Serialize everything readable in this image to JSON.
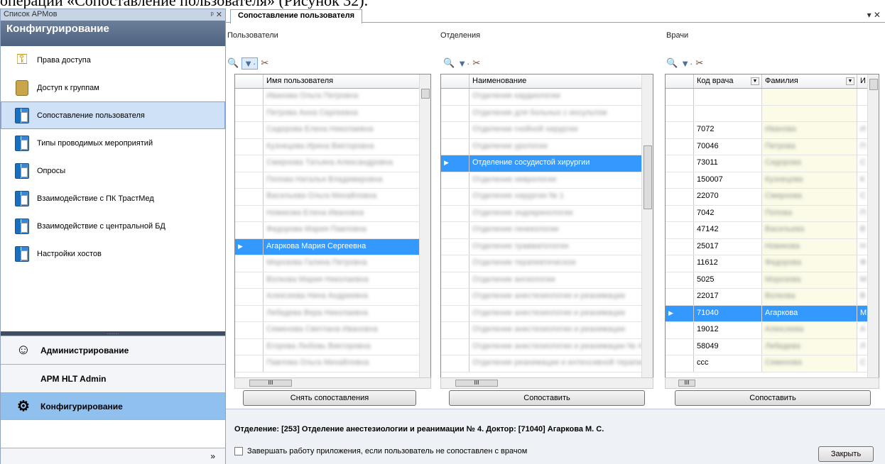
{
  "page_top_text": "операции «Сопоставление пользователя» (Рисунок 32).",
  "left_panel": {
    "title": "Список АРМов",
    "pin_controls": "ᵖ ✕",
    "header": "Конфигурирование",
    "items": [
      {
        "label": "Права доступа",
        "icon": "keys-icon"
      },
      {
        "label": "Доступ к группам",
        "icon": "lock-icon"
      },
      {
        "label": "Сопоставление пользователя",
        "icon": "book-icon",
        "selected": true
      },
      {
        "label": "Типы проводимых мероприятий",
        "icon": "book-icon"
      },
      {
        "label": "Опросы",
        "icon": "book-icon"
      },
      {
        "label": "Взаимодействие с ПК ТрастМед",
        "icon": "book-icon"
      },
      {
        "label": "Взаимодействие с центральной БД",
        "icon": "book-icon"
      },
      {
        "label": "Настройки хостов",
        "icon": "book-icon"
      }
    ],
    "splitter_dots": "..........",
    "bottom_buttons": [
      {
        "label": "Администрирование",
        "icon": "admin-icon"
      },
      {
        "label": "АРМ HLT Admin",
        "icon": ""
      },
      {
        "label": "Конфигурирование",
        "icon": "config-icon",
        "active": true
      }
    ],
    "more_label": "»"
  },
  "tab": {
    "label": "Сопоставление пользователя",
    "controls": "▾ ✕"
  },
  "users": {
    "title": "Пользователи",
    "column": "Имя пользователя",
    "rows": [
      {
        "name": "Иванова Ольга Петровна",
        "blurred": true
      },
      {
        "name": "Петрова Анна Сергеевна",
        "blurred": true
      },
      {
        "name": "Сидорова Елена Николаевна",
        "blurred": true
      },
      {
        "name": "Кузнецова Ирина Викторовна",
        "blurred": true
      },
      {
        "name": "Смирнова Татьяна Александровна",
        "blurred": true
      },
      {
        "name": "Попова Наталья Владимировна",
        "blurred": true
      },
      {
        "name": "Васильева Ольга Михайловна",
        "blurred": true
      },
      {
        "name": "Новикова Елена Ивановна",
        "blurred": true
      },
      {
        "name": "Федорова Мария Павловна",
        "blurred": true
      },
      {
        "name": "Агаркова Мария Сергеевна",
        "blurred": false,
        "selected": true
      },
      {
        "name": "Морозова Галина Петровна",
        "blurred": true
      },
      {
        "name": "Волкова Мария Николаевна",
        "blurred": true
      },
      {
        "name": "Алексеева Нина Андреевна",
        "blurred": true
      },
      {
        "name": "Лебедева Вера Николаевна",
        "blurred": true
      },
      {
        "name": "Семенова Светлана Ивановна",
        "blurred": true
      },
      {
        "name": "Егорова Любовь Викторовна",
        "blurred": true
      },
      {
        "name": "Павлова Ольга Михайловна",
        "blurred": true
      }
    ],
    "button": "Снять сопоставления",
    "hscroll": "III"
  },
  "departments": {
    "title": "Отделения",
    "column": "Наименование",
    "rows": [
      {
        "name": "Отделение кардиологии",
        "blurred": true
      },
      {
        "name": "Отделение для больных с инсультом",
        "blurred": true
      },
      {
        "name": "Отделение гнойной хирургии",
        "blurred": true
      },
      {
        "name": "Отделение урологии",
        "blurred": true
      },
      {
        "name": "Отделение сосудистой хирургии",
        "blurred": false,
        "selected": true
      },
      {
        "name": "Отделение неврологии",
        "blurred": true
      },
      {
        "name": "Отделение хирургии № 1",
        "blurred": true
      },
      {
        "name": "Отделение эндокринологии",
        "blurred": true
      },
      {
        "name": "Отделение гинекологии",
        "blurred": true
      },
      {
        "name": "Отделение травматологии",
        "blurred": true
      },
      {
        "name": "Отделение терапевтическое",
        "blurred": true
      },
      {
        "name": "Отделение ангиологии",
        "blurred": true
      },
      {
        "name": "Отделение анестезиологии и реанимации",
        "blurred": true
      },
      {
        "name": "Отделение анестезиологии и реанимации",
        "blurred": true
      },
      {
        "name": "Отделение анестезиологии и реанимации",
        "blurred": true
      },
      {
        "name": "Отделение анестезиологии и реанимации № 4",
        "blurred": true
      },
      {
        "name": "Отделение реанимации и интенсивной терапии",
        "blurred": true
      }
    ],
    "button": "Сопоставить",
    "hscroll": "III"
  },
  "doctors": {
    "title": "Врачи",
    "columns": [
      "Код врача",
      "Фамилия",
      "И"
    ],
    "rows": [
      {
        "code": "",
        "surname": "",
        "blurred": false
      },
      {
        "code": "",
        "surname": "",
        "blurred": false
      },
      {
        "code": "7072",
        "surname": "Иванова",
        "initial": "И",
        "blurred": true
      },
      {
        "code": "70046",
        "surname": "Петрова",
        "initial": "П",
        "blurred": true
      },
      {
        "code": "73011",
        "surname": "Сидорова",
        "initial": "С",
        "blurred": true
      },
      {
        "code": "150007",
        "surname": "Кузнецова",
        "initial": "К",
        "blurred": true
      },
      {
        "code": "22070",
        "surname": "Смирнова",
        "initial": "С",
        "blurred": true
      },
      {
        "code": "7042",
        "surname": "Попова",
        "initial": "П",
        "blurred": true
      },
      {
        "code": "47142",
        "surname": "Васильева",
        "initial": "В",
        "blurred": true
      },
      {
        "code": "25017",
        "surname": "Новикова",
        "initial": "Н",
        "blurred": true
      },
      {
        "code": "11612",
        "surname": "Федорова",
        "initial": "Ф",
        "blurred": true
      },
      {
        "code": "5025",
        "surname": "Морозова",
        "initial": "М",
        "blurred": true
      },
      {
        "code": "22017",
        "surname": "Волкова",
        "initial": "В",
        "blurred": true
      },
      {
        "code": "71040",
        "surname": "Агаркова",
        "initial": "M",
        "blurred": false,
        "selected": true
      },
      {
        "code": "19012",
        "surname": "Алексеева",
        "initial": "А",
        "blurred": true
      },
      {
        "code": "58049",
        "surname": "Лебедева",
        "initial": "Л",
        "blurred": true
      },
      {
        "code": "ccc",
        "surname": "Семенова",
        "initial": "С",
        "blurred": true
      }
    ],
    "button": "Сопоставить",
    "hscroll": "III"
  },
  "footer": {
    "status": "Отделение: [253] Отделение анестезиологии и реанимации № 4. Доктор: [71040] Агаркова М. С.",
    "checkbox_label": "Завершать работу приложения, если пользователь не сопоставлен с врачом",
    "checkbox_checked": false,
    "close_button": "Закрыть"
  },
  "toolbar": {
    "find_icon": "binoculars-icon",
    "filter_icon": "filter-icon",
    "tool_icon": "tools-icon",
    "find_glyph": "🔍",
    "filter_glyph": "▼·",
    "tool_glyph": "✂"
  },
  "colors": {
    "selection": "#3399ff",
    "active_nav": "#8fc0ee",
    "header_bg": "#4e6380"
  }
}
